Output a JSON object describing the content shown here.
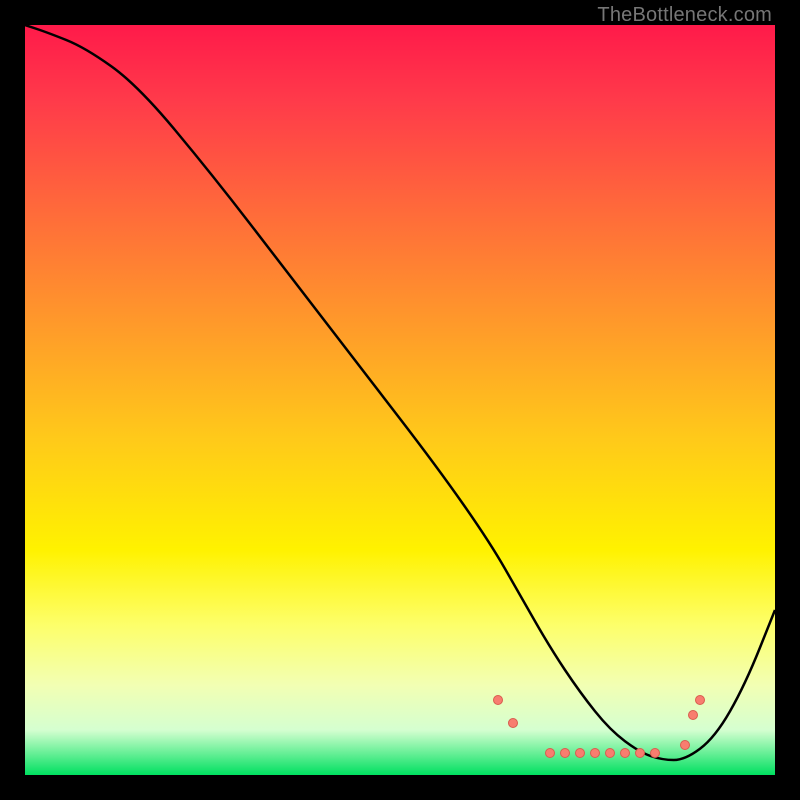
{
  "watermark": "TheBottleneck.com",
  "chart_data": {
    "type": "line",
    "title": "",
    "xlabel": "",
    "ylabel": "",
    "xlim": [
      0,
      100
    ],
    "ylim": [
      0,
      100
    ],
    "series": [
      {
        "name": "bottleneck-curve",
        "x": [
          0,
          3,
          8,
          15,
          25,
          35,
          45,
          55,
          62,
          66,
          70,
          74,
          78,
          82,
          85,
          88,
          92,
          96,
          100
        ],
        "y": [
          100,
          99,
          97,
          92,
          80,
          67,
          54,
          41,
          31,
          24,
          17,
          11,
          6,
          3,
          2,
          2,
          5,
          12,
          22
        ]
      }
    ],
    "markers": {
      "name": "highlight-dots",
      "x": [
        63,
        65,
        70,
        72,
        74,
        76,
        78,
        80,
        82,
        84,
        88,
        89,
        90
      ],
      "y": [
        10,
        7,
        3,
        3,
        3,
        3,
        3,
        3,
        3,
        3,
        4,
        8,
        10
      ]
    },
    "background": {
      "type": "vertical-gradient",
      "stops": [
        {
          "pos": 0,
          "color": "#ff1a4a"
        },
        {
          "pos": 25,
          "color": "#ff6b3a"
        },
        {
          "pos": 55,
          "color": "#ffc91a"
        },
        {
          "pos": 80,
          "color": "#fdff6a"
        },
        {
          "pos": 100,
          "color": "#00e060"
        }
      ]
    }
  }
}
